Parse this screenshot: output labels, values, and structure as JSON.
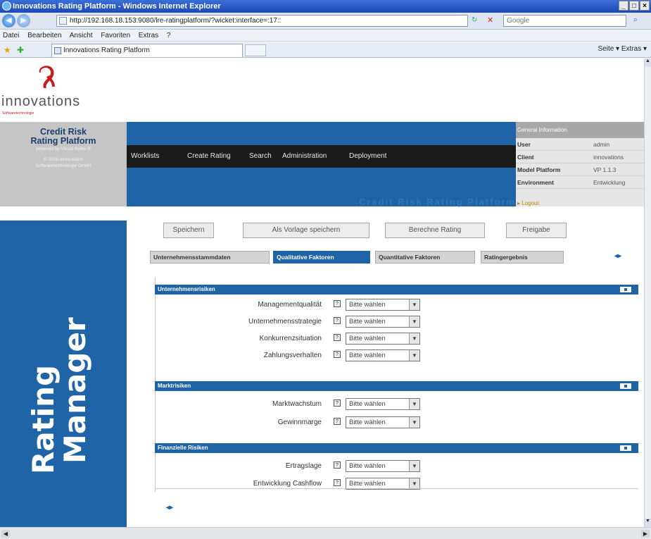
{
  "browser": {
    "window_title": "Innovations Rating Platform - Windows Internet Explorer",
    "address": "http://192.168.18.153:9080/lre-ratingplatform/?wicket:interface=:17::",
    "search_placeholder": "Google",
    "menu": [
      "Datei",
      "Bearbeiten",
      "Ansicht",
      "Favoriten",
      "Extras",
      "?"
    ],
    "tab_title": "Innovations Rating Platform",
    "tools": "Seite ▾  Extras ▾"
  },
  "logo": {
    "text": "innovations",
    "subtext": "Softwaretechnologie"
  },
  "platform": {
    "title_line1": "Credit Risk",
    "title_line2": "Rating Platform",
    "powered": "powered by Visual Rules ®",
    "copyright": "© 2008 Innovations",
    "company": "Softwaretechnologie GmbH"
  },
  "nav": {
    "items": [
      "Worklists",
      "Create Rating",
      "Search",
      "Administration",
      "Deployment"
    ]
  },
  "watermark": "Credit Risk Rating Platform",
  "general_info": {
    "header": "General Information",
    "rows": [
      {
        "k": "User",
        "v": "admin"
      },
      {
        "k": "Client",
        "v": "innovations"
      },
      {
        "k": "Model Platform",
        "v": "VP 1.1.3"
      },
      {
        "k": "Environment",
        "v": "Entwicklung"
      }
    ],
    "logout": "▸ Logout"
  },
  "sidebar": {
    "line1": "Rating",
    "line2": "Manager"
  },
  "actions": [
    "Speichern",
    "Als Vorlage speichern",
    "Berechne Rating",
    "Freigabe"
  ],
  "tabs": [
    {
      "label": "Unternehmensstammdaten",
      "active": false
    },
    {
      "label": "Qualitative Faktoren",
      "active": true
    },
    {
      "label": "Quantitative Faktoren",
      "active": false
    },
    {
      "label": "Ratingergebnis",
      "active": false
    }
  ],
  "sections": [
    {
      "title": "Unternehmensrisiken",
      "fields": [
        {
          "label": "Managementqualität",
          "value": "Bitte wählen"
        },
        {
          "label": "Unternehmensstrategie",
          "value": "Bitte wählen"
        },
        {
          "label": "Konkurrenzsituation",
          "value": "Bitte wählen"
        },
        {
          "label": "Zahlungsverhalten",
          "value": "Bitte wählen"
        }
      ]
    },
    {
      "title": "Marktrisiken",
      "fields": [
        {
          "label": "Marktwachstum",
          "value": "Bitte wählen"
        },
        {
          "label": "Gewinnmarge",
          "value": "Bitte wählen"
        }
      ]
    },
    {
      "title": "Finanzielle Risiken",
      "fields": [
        {
          "label": "Ertragslage",
          "value": "Bitte wählen"
        },
        {
          "label": "Entwicklung Cashflow",
          "value": "Bitte wählen"
        }
      ]
    }
  ],
  "colors": {
    "primary": "#1e64a6",
    "nav_strip": "#1a1a1a",
    "info_bg": "#e6e6e6"
  }
}
